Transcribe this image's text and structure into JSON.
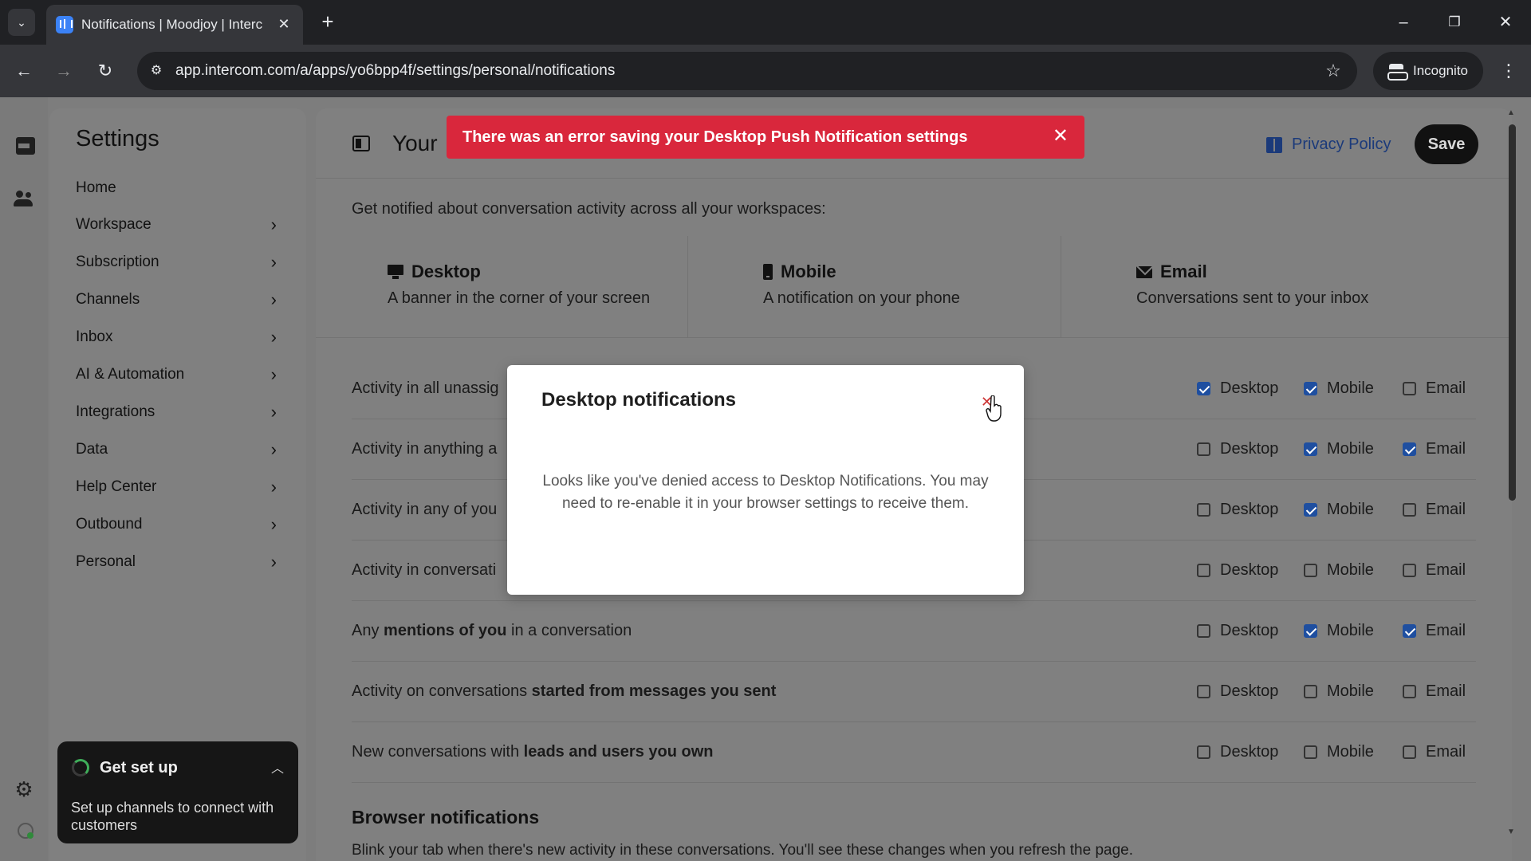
{
  "browser": {
    "tab_title": "Notifications | Moodjoy | Interc",
    "url": "app.intercom.com/a/apps/yo6bpp4f/settings/personal/notifications",
    "profile_label": "Incognito"
  },
  "sidebar": {
    "title": "Settings",
    "items": [
      {
        "label": "Home",
        "has_chevron": false
      },
      {
        "label": "Workspace",
        "has_chevron": true
      },
      {
        "label": "Subscription",
        "has_chevron": true
      },
      {
        "label": "Channels",
        "has_chevron": true
      },
      {
        "label": "Inbox",
        "has_chevron": true
      },
      {
        "label": "AI & Automation",
        "has_chevron": true
      },
      {
        "label": "Integrations",
        "has_chevron": true
      },
      {
        "label": "Data",
        "has_chevron": true
      },
      {
        "label": "Help Center",
        "has_chevron": true
      },
      {
        "label": "Outbound",
        "has_chevron": true
      },
      {
        "label": "Personal",
        "has_chevron": true
      }
    ]
  },
  "setup": {
    "title": "Get set up",
    "description": "Set up channels to connect with customers"
  },
  "header": {
    "title": "Your",
    "privacy_label": "Privacy Policy",
    "save_label": "Save"
  },
  "toast": {
    "message": "There was an error saving your Desktop Push Notification settings",
    "color": "#d9273c"
  },
  "intro": "Get notified about conversation activity across all your workspaces:",
  "channels": [
    {
      "name": "Desktop",
      "description": "A banner in the corner of your screen",
      "icon": "desktop-icon"
    },
    {
      "name": "Mobile",
      "description": "A notification on your phone",
      "icon": "mobile-icon"
    },
    {
      "name": "Email",
      "description": "Conversations sent to your inbox",
      "icon": "email-icon"
    }
  ],
  "option_labels": {
    "desktop": "Desktop",
    "mobile": "Mobile",
    "email": "Email"
  },
  "rows": [
    {
      "parts": [
        {
          "t": "Activity in all unassig",
          "b": false
        }
      ],
      "desktop": true,
      "mobile": true,
      "email": false
    },
    {
      "parts": [
        {
          "t": "Activity in anything a",
          "b": false
        }
      ],
      "desktop": false,
      "mobile": true,
      "email": true
    },
    {
      "parts": [
        {
          "t": "Activity in any of you",
          "b": false
        }
      ],
      "desktop": false,
      "mobile": true,
      "email": false
    },
    {
      "parts": [
        {
          "t": "Activity in conversati",
          "b": false
        }
      ],
      "desktop": false,
      "mobile": false,
      "email": false
    },
    {
      "parts": [
        {
          "t": "Any ",
          "b": false
        },
        {
          "t": "mentions of you",
          "b": true
        },
        {
          "t": " in a conversation",
          "b": false
        }
      ],
      "desktop": false,
      "mobile": true,
      "email": true
    },
    {
      "parts": [
        {
          "t": "Activity on conversations ",
          "b": false
        },
        {
          "t": "started from messages you sent",
          "b": true
        }
      ],
      "desktop": false,
      "mobile": false,
      "email": false
    },
    {
      "parts": [
        {
          "t": "New conversations with ",
          "b": false
        },
        {
          "t": "leads and users you own",
          "b": true
        }
      ],
      "desktop": false,
      "mobile": false,
      "email": false
    }
  ],
  "browser_section": {
    "title": "Browser notifications",
    "description": "Blink your tab when there's new activity in these conversations. You'll see these changes when you refresh the page."
  },
  "modal": {
    "title": "Desktop notifications",
    "body": "Looks like you've denied access to Desktop Notifications. You may need to re-enable it in your browser settings to receive them."
  },
  "colors": {
    "accent": "#1f4fa0",
    "error": "#d9273c",
    "save_button": "#111111"
  }
}
